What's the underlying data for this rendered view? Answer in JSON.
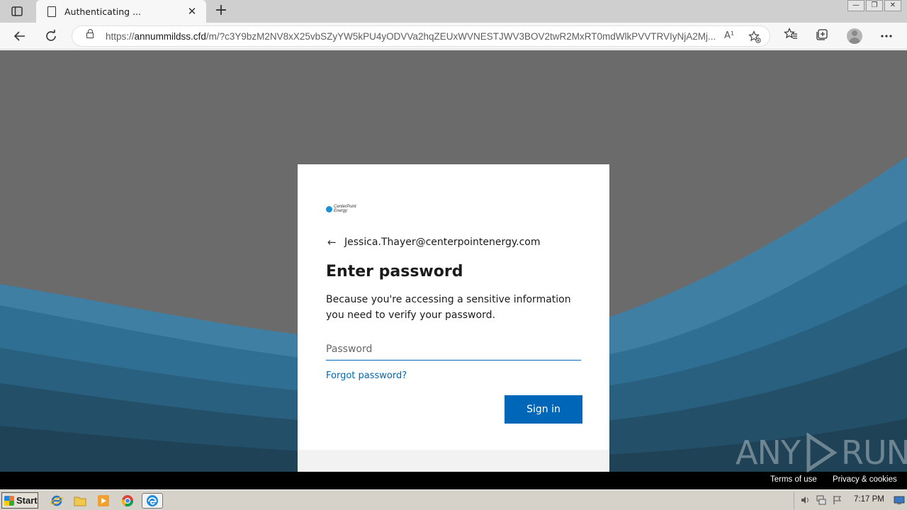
{
  "browser": {
    "tab_title": "Authenticating ...",
    "tab_close": "✕",
    "new_tab": "+",
    "url_prefix": "https://",
    "url_host": "annummildss.cfd",
    "url_rest": "/m/?c3Y9bzM2NV8xX25vbSZyYW5kPU4yODVVa2hqZEUxWVNESTJWV3BOV2twR2MxRT0mdWlkPVVTRVIyNjA2Mj...",
    "read_aloud": "A¹",
    "window_controls": [
      "—",
      "❐",
      "✕"
    ]
  },
  "login": {
    "logo_text": "CenterPoint Energy",
    "back_arrow": "←",
    "email": "Jessica.Thayer@centerpointenergy.com",
    "heading": "Enter password",
    "description": "Because you're accessing a sensitive information you need to verify your password.",
    "password_placeholder": "Password",
    "forgot_label": "Forgot password?",
    "signin_label": "Sign in"
  },
  "footer": {
    "terms": "Terms of use",
    "privacy": "Privacy & cookies"
  },
  "watermark": {
    "left": "ANY",
    "right": "RUN"
  },
  "taskbar": {
    "start_label": "Start",
    "clock": "7:17 PM"
  },
  "colors": {
    "accent": "#0067b8",
    "background_gray": "#6b6b6b",
    "wave_blue": "#2a6f96"
  }
}
